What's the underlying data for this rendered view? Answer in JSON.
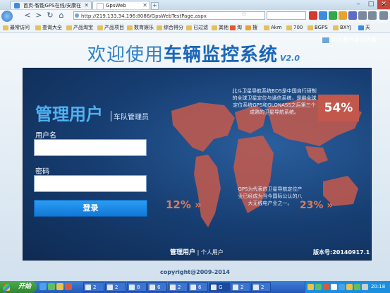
{
  "browser": {
    "tabs": [
      {
        "label": "首页-智能GPS在线/安康在"
      },
      {
        "label": "GpsWeb"
      }
    ],
    "new_tab": "+",
    "window_controls": {
      "minimize": "–",
      "maximize": "□",
      "close": "✕"
    },
    "nav": {
      "back": "<",
      "forward": ">",
      "reload": "↻",
      "home": "⌂"
    },
    "url": "http://219.133.34.196:8086/GpsWebTestPage.aspx",
    "bookmarks": [
      "最常访问",
      "查询大全",
      "产品淘宝",
      "产品项目",
      "数育娱乐",
      "综合得分",
      "已过滤",
      "其他",
      "淘",
      "搜",
      "Akm",
      "700",
      "BGPS",
      "BXYJ",
      "天"
    ],
    "bookmarks_more": "»"
  },
  "page": {
    "headline_prefix": "欢迎使用",
    "headline_bold": "车辆监控系统",
    "headline_version": "V2.0",
    "add_home_link": "加入我的桌面收藏",
    "login": {
      "title": "管理用户",
      "subtitle": "车队管理员",
      "username_label": "用户名",
      "username_value": "",
      "password_label": "密码",
      "password_value": "",
      "submit_label": "登录"
    },
    "promo": {
      "bds_text": "北斗卫星导航系统BDS是中国自行研制的全球卫星定位与通信系统，是继全球定位系统GPS和GLONASS之后第三个成熟的卫星导航系统。",
      "gps_text": "GPS为代表的卫星导航定位产业已经成为当今国际公认的八大无线电产业之一。",
      "stat_54": "54%",
      "stat_12": "12%",
      "stat_23": "23%",
      "arrows": "»"
    },
    "login_switch": {
      "active": "管理用户",
      "separator": "|",
      "other": "个人用户"
    },
    "version_number": "版本号:20140917.1",
    "copyright": "copyright@2009-2014"
  },
  "taskbar": {
    "start_label": "开始",
    "items": [
      "2",
      "2",
      "8",
      "6",
      "2",
      "6",
      "G",
      "2",
      "2"
    ],
    "clock": "20:18"
  }
}
